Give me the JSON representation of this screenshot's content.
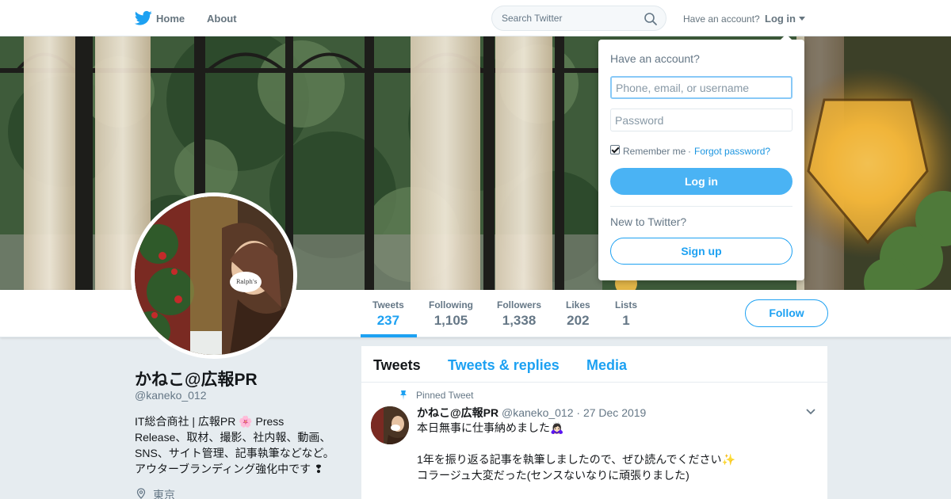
{
  "topnav": {
    "logo_icon": "twitter-bird-icon",
    "home_label": "Home",
    "about_label": "About",
    "search_placeholder": "Search Twitter",
    "search_icon": "search-icon",
    "have_account_label": "Have an account?",
    "login_label": "Log in"
  },
  "profile_nav": {
    "stats": [
      {
        "label": "Tweets",
        "value": "237"
      },
      {
        "label": "Following",
        "value": "1,105"
      },
      {
        "label": "Followers",
        "value": "1,338"
      },
      {
        "label": "Likes",
        "value": "202"
      },
      {
        "label": "Lists",
        "value": "1"
      }
    ],
    "follow_label": "Follow"
  },
  "profile": {
    "display_name": "かねこ@広報PR",
    "handle": "@kaneko_012",
    "bio_lines": [
      "IT総合商社 | 広報PR 🌸 Press",
      "Release、取材、撮影、社内報、動画、",
      "SNS、サイト管理、記事執筆などなど。",
      "アウターブランディング強化中です ❢"
    ],
    "location_icon": "location-pin-icon",
    "location": "東京"
  },
  "timeline": {
    "tabs": [
      "Tweets",
      "Tweets & replies",
      "Media"
    ],
    "pinned_icon": "pin-icon",
    "pinned_label": "Pinned Tweet",
    "tweet": {
      "author": "かねこ@広報PR",
      "meta": "@kaneko_012 · 27 Dec 2019",
      "lines": [
        "本日無事に仕事納めました🙇🏻‍♀️",
        "",
        "1年を振り返る記事を執筆しましたので、ぜひ読んでください✨",
        "コラージュ大変だった(センスないなりに頑張りました)"
      ]
    }
  },
  "login_dropdown": {
    "title": "Have an account?",
    "username_placeholder": "Phone, email, or username",
    "password_placeholder": "Password",
    "remember_label": "Remember me",
    "separator": "·",
    "forgot_label": "Forgot password?",
    "login_button": "Log in",
    "new_label": "New to Twitter?",
    "signup_button": "Sign up"
  },
  "colors": {
    "accent": "#1da1f2",
    "login_button": "#4ab3f4",
    "page_bg": "#e6ecf0"
  }
}
